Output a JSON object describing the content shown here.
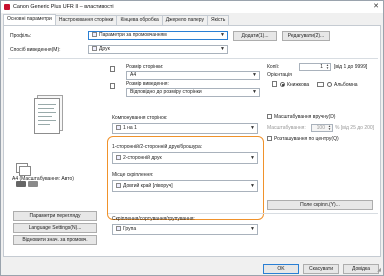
{
  "window": {
    "title": "Canon Generic Plus UFR II – властивості",
    "close_glyph": "✕"
  },
  "tabs": [
    "Основні параметри",
    "Настроювання сторінки",
    "Кінцева обробка",
    "Джерело паперу",
    "Якість"
  ],
  "profile": {
    "label": "Профіль:",
    "value": "Параметри за промовчанням",
    "add_button": "Додати(1)...",
    "edit_button": "Редагувати(2)..."
  },
  "output_method": {
    "label": "Спосіб виведення(M):",
    "value": "Друк"
  },
  "preview_caption": "A4 (Масштабування: Авто)",
  "page_size": {
    "label": "Розмір сторінки:",
    "value": "A4"
  },
  "output_size": {
    "label": "Розмір виведення:",
    "value": "Відповідно до розміру сторінки"
  },
  "copies": {
    "label": "Копії:",
    "value": "1",
    "range": "[від 1 до 9999]"
  },
  "orientation": {
    "label": "Орієнтація",
    "portrait": "Книжкова",
    "landscape": "Альбомна",
    "selected": "portrait"
  },
  "page_layout": {
    "label": "Компонування сторінок:",
    "value": "1 на 1"
  },
  "manual_scaling": {
    "label": "Масштабування вручну(D)",
    "scaling_label": "Масштабування:",
    "value": "100",
    "range": "% [від 25 до 200]"
  },
  "watermark_label": "Розташування по центру(Q)",
  "duplex": {
    "label": "1-сторонній/2-сторонній друк/брошура:",
    "value": "2-сторонній друк"
  },
  "binding": {
    "label": "Місце скріплення:",
    "value": "Довгий край [ліворуч]"
  },
  "binding_margin_button": "Поле скріпл.(Y)...",
  "collate": {
    "label": "Скріплення/сортування/групування:",
    "value": "Група"
  },
  "left_buttons": [
    "Параметри перегляду",
    "Language Settings(N)...",
    "Відновити знач. за промовч."
  ],
  "footer": {
    "ok": "OK",
    "cancel": "Скасувати",
    "help": "Довідка"
  }
}
